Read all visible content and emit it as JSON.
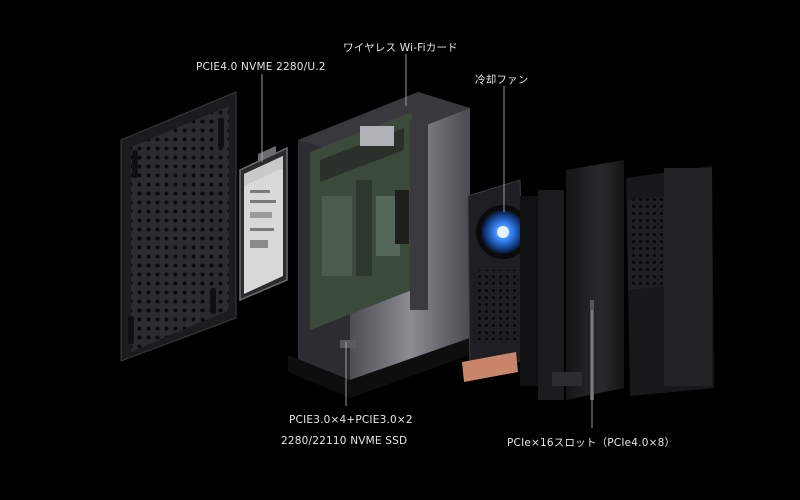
{
  "labels": {
    "ssd": "PCIE4.0 NVME 2280/U.2",
    "wifi": "ワイヤレス Wi-Fiカード",
    "fan": "冷却ファン",
    "nvme_line1": "PCIE3.0×4+PCIE3.0×2",
    "nvme_line2": "2280/22110 NVME SSD",
    "pcie_slot": "PCIe×16スロット（PCIe4.0×8）"
  },
  "colors": {
    "background": "#000000",
    "panel_dark": "#1b1b1d",
    "panel_mid": "#2a2a2d",
    "metal": "#6c6d72",
    "pcb": "#3c4a3c",
    "fan_glow": "#3a8cff",
    "copper": "#c9846a",
    "leader": "#bdbdbd"
  }
}
